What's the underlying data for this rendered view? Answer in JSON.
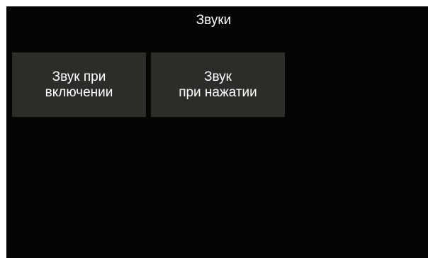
{
  "screen": {
    "title": "Звуки",
    "tiles": [
      {
        "line1": "Звук при",
        "line2": "включении"
      },
      {
        "line1": "Звук",
        "line2": "при нажатии"
      }
    ]
  },
  "colors": {
    "screen_background": "#050405",
    "tile_background": "#2e2c29",
    "text": "#ffffff"
  }
}
